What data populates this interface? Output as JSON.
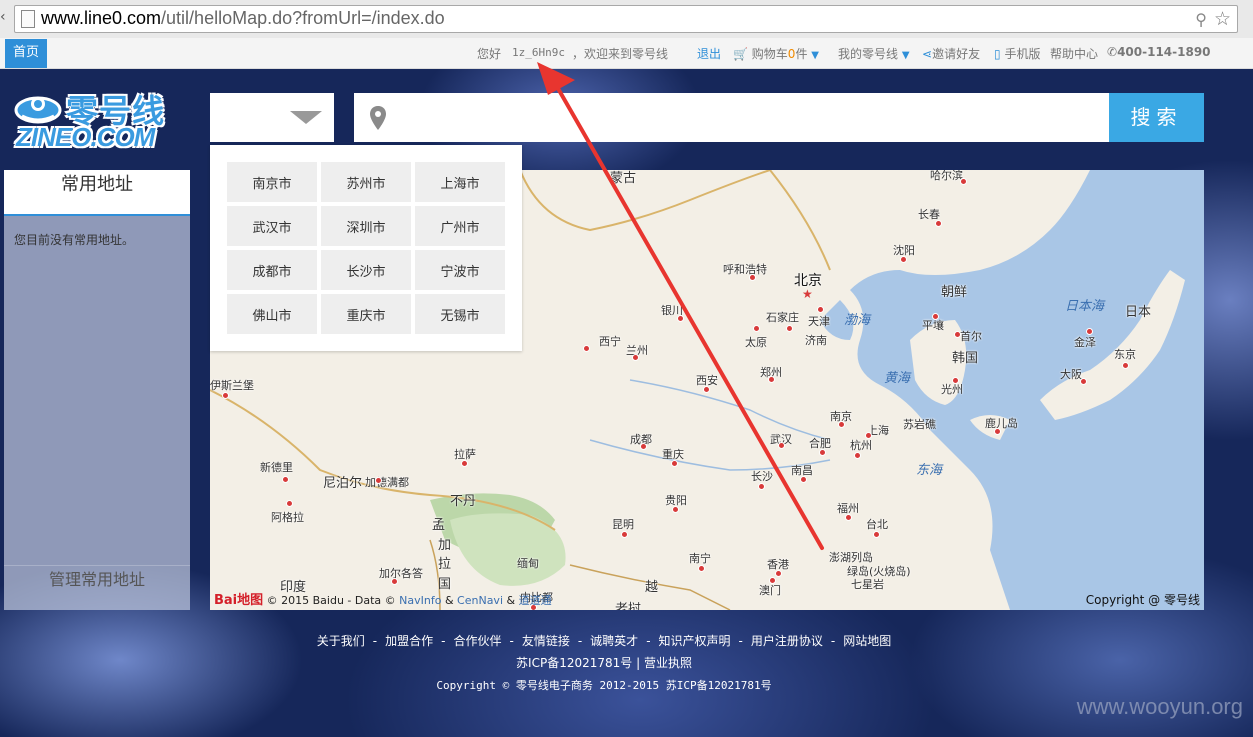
{
  "browser": {
    "url_host": "www.line0.com",
    "url_path": "/util/helloMap.do?fromUrl=/index.do"
  },
  "topnav": {
    "home": "首页",
    "greeting": "您好",
    "username": "1z_6Hn9c",
    "welcome": "，欢迎来到零号线",
    "logout": "退出",
    "cart_label": "购物车",
    "cart_count": "0",
    "cart_unit": "件",
    "mine": "我的零号线",
    "invite": "邀请好友",
    "mobile": "手机版",
    "help": "帮助中心",
    "phone": "400-114-1890"
  },
  "logo": {
    "cn": "零号线",
    "en": "ZINEO.COM"
  },
  "search": {
    "button": "搜索"
  },
  "city_panel": {
    "cities": [
      "南京市",
      "苏州市",
      "上海市",
      "武汉市",
      "深圳市",
      "广州市",
      "成都市",
      "长沙市",
      "宁波市",
      "佛山市",
      "重庆市",
      "无锡市"
    ]
  },
  "left_panel": {
    "title": "常用地址",
    "empty_text": "您目前没有常用地址。",
    "manage": "管理常用地址"
  },
  "map": {
    "labels": {
      "mongolia": "蒙古",
      "harbin": "哈尔滨",
      "changchun": "长春",
      "shenyang": "沈阳",
      "hohhot": "呼和浩特",
      "beijing": "北京",
      "shijiazhuang": "石家庄",
      "tianjin": "天津",
      "bohai": "渤海",
      "chaoxian": "朝鲜",
      "pyongyang": "平壤",
      "seoul": "首尔",
      "korea": "韩国",
      "gwangju": "光州",
      "japan_sea": "日本海",
      "japan": "日本",
      "kanazawa": "金泽",
      "osaka": "大阪",
      "tokyo": "东京",
      "yinchuan": "银川",
      "taiyuan": "太原",
      "jinan": "济南",
      "xining": "西宁",
      "lanzhou": "兰州",
      "zhengzhou": "郑州",
      "huanghai": "黄海",
      "xian": "西安",
      "nanjing": "南京",
      "shanghai": "上海",
      "sujiao": "苏岩礁",
      "kagoshima": "鹿儿岛",
      "islamabad": "伊斯兰堡",
      "chengdu": "成都",
      "wuhan": "武汉",
      "hefei": "合肥",
      "hangzhou": "杭州",
      "lhasa": "拉萨",
      "chongqing": "重庆",
      "donghai": "东海",
      "newdelhi": "新德里",
      "nepal": "尼泊尔",
      "kathmandu": "加德满都",
      "changsha": "长沙",
      "nanchang": "南昌",
      "bhutan": "不丹",
      "guiyang": "贵阳",
      "fuzhou": "福州",
      "agra": "阿格拉",
      "bangla1": "孟",
      "bangla2": "加",
      "bangla3": "拉",
      "bangla4": "国",
      "kunming": "昆明",
      "taipei": "台北",
      "myanmar": "缅甸",
      "nanning": "南宁",
      "hongkong": "香港",
      "penghu": "澎湖列岛",
      "lvdao": "绿岛(火烧岛)",
      "qixingyan": "七星岩",
      "macau": "澳门",
      "india": "印度",
      "kolkata": "加尔各答",
      "neibidu": "内比都",
      "laos": "老挝",
      "vietnam": "越"
    },
    "baidu_logo": "Bai地图",
    "baidu_copy": "© 2015 Baidu - Data ©",
    "navinfo": "NavInfo",
    "amp": "&",
    "cennavi": "CenNavi",
    "amp2": "&",
    "daodao": "道道通",
    "copyright": "Copyright @ 零号线"
  },
  "footer": {
    "links": [
      "关于我们",
      "加盟合作",
      "合作伙伴",
      "友情链接",
      "诚聘英才",
      "知识产权声明",
      "用户注册协议",
      "网站地图"
    ],
    "icp": "苏ICP备12021781号 | 营业执照",
    "copyright": "Copyright © 零号线电子商务 2012-2015 苏ICP备12021781号"
  },
  "watermark": "www.wooyun.org",
  "colors": {
    "accent": "#2f8fd8",
    "search_button": "#3aa8e4",
    "annotation_arrow": "#e8352f"
  },
  "icons": [
    "page-icon",
    "pin-icon",
    "star-icon",
    "cart-icon",
    "share-icon",
    "mobile-icon",
    "phone-icon",
    "location-pin-icon",
    "dropdown-caret-icon"
  ]
}
